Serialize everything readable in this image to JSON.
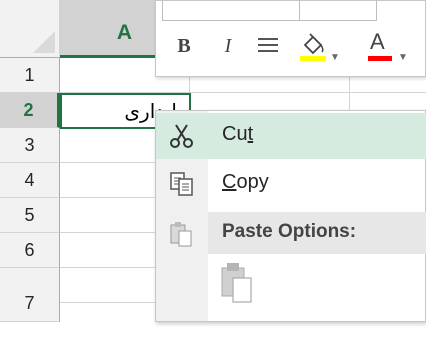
{
  "spreadsheet": {
    "column_headers": [
      "A"
    ],
    "row_headers": [
      "1",
      "2",
      "3",
      "4",
      "5",
      "6",
      "7"
    ],
    "selected_cell_value": "پایداری"
  },
  "mini_toolbar": {
    "bold_label": "B",
    "italic_label": "I",
    "font_color_label": "A",
    "fill_color": "#ffff00",
    "font_color": "#ff0000"
  },
  "context_menu": {
    "items": [
      {
        "label": "Cut",
        "underline": "t",
        "icon": "scissors-icon"
      },
      {
        "label": "Copy",
        "underline": "C",
        "icon": "copy-icon"
      }
    ],
    "paste_options_label": "Paste Options:"
  },
  "colors": {
    "accent": "#217346",
    "hover": "#d5ebdf"
  }
}
